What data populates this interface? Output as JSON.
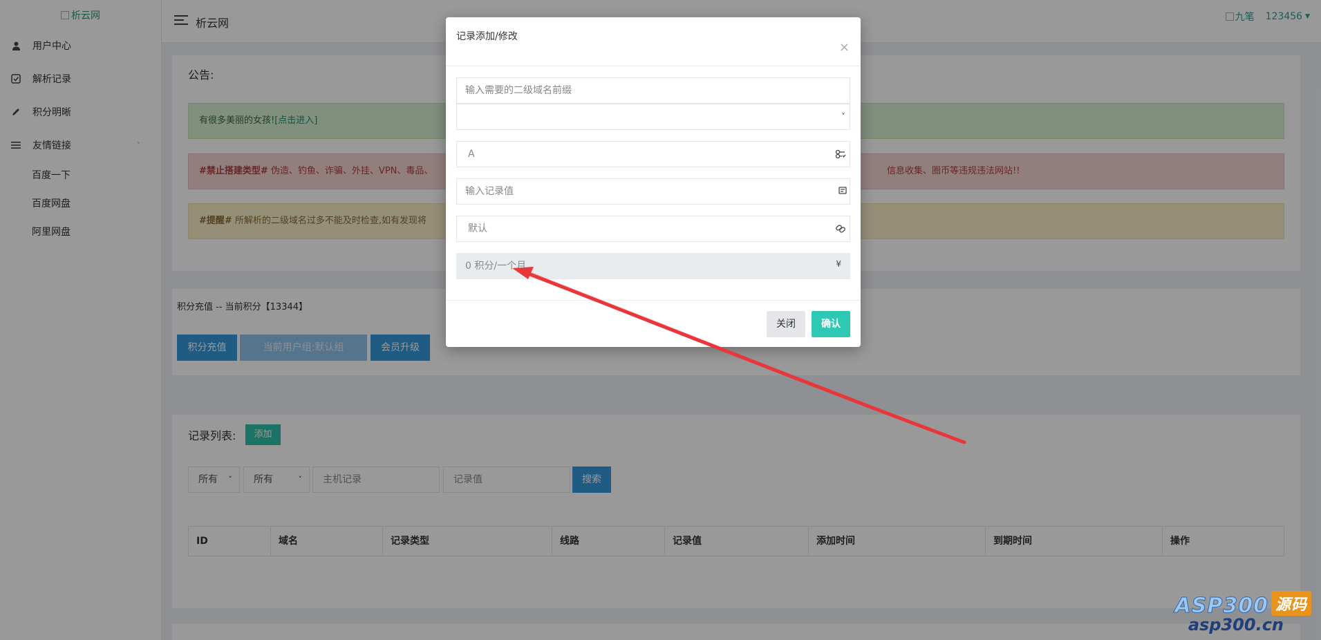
{
  "sidebar": {
    "logo_alt": "析云网",
    "items": [
      {
        "label": "用户中心",
        "icon": "user-icon"
      },
      {
        "label": "解析记录",
        "icon": "notebook-icon"
      },
      {
        "label": "积分明晰",
        "icon": "pencil-icon"
      },
      {
        "label": "友情链接",
        "icon": "list-icon"
      }
    ],
    "sub_items": [
      "百度一下",
      "百度网盘",
      "阿里网盘"
    ]
  },
  "header": {
    "title": "析云网",
    "user_name": "九笔",
    "user_id": "123456"
  },
  "notice": {
    "title": "公告:",
    "success_text": "有很多美丽的女孩!",
    "success_link": "[点击进入]",
    "danger_bold": "#禁止搭建类型#",
    "danger_text": " 伪造、钓鱼、诈骗、外挂、VPN、毒品、",
    "danger_tail": "信息收集、圈币等违规违法网站!!",
    "warning_bold": "#提醒#",
    "warning_text": " 所解析的二级域名过多不能及时检查,如有发现将"
  },
  "points": {
    "title": "积分充值 -- 当前积分【13344】",
    "recharge": "积分充值",
    "group": "当前用户组:默认组",
    "upgrade": "会员升级"
  },
  "records": {
    "title": "记录列表:",
    "add": "添加",
    "filter_type": "所有",
    "filter_line": "所有",
    "host_placeholder": "主机记录",
    "value_placeholder": "记录值",
    "search": "搜索",
    "columns": [
      "ID",
      "域名",
      "记录类型",
      "线路",
      "记录值",
      "添加时间",
      "到期时间",
      "操作"
    ]
  },
  "modal": {
    "title": "记录添加/修改",
    "close_x": "×",
    "prefix_placeholder": "输入需要的二级域名前缀",
    "type_value": "A",
    "record_value_placeholder": "输入记录值",
    "line_value": "默认",
    "cost_value": "0 积分/一个月",
    "cost_icon": "¥",
    "btn_close": "关闭",
    "btn_confirm": "确认"
  },
  "watermark": {
    "brand": "ASP300",
    "source": "源码",
    "url": "asp300.cn"
  },
  "colors": {
    "accent": "#2fc8b4",
    "primary": "#3498db",
    "arrow": "#e8373a"
  }
}
